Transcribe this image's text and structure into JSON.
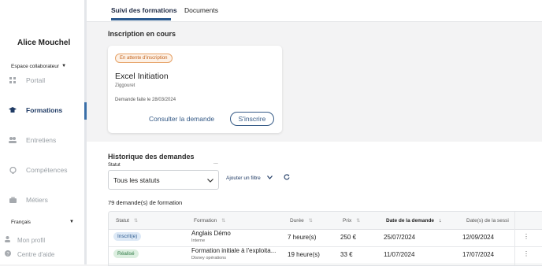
{
  "sidebar": {
    "user_name": "Alice Mouchel",
    "space_select": "Espace collaborateur",
    "nav": [
      {
        "label": "Portail",
        "icon": "grid-icon"
      },
      {
        "label": "Formations",
        "icon": "graduation-cap-icon",
        "active": true
      },
      {
        "label": "Entretiens",
        "icon": "people-icon"
      },
      {
        "label": "Compétences",
        "icon": "badge-icon"
      },
      {
        "label": "Métiers",
        "icon": "briefcase-icon"
      }
    ],
    "language": "Français",
    "footer": [
      {
        "label": "Mon profil",
        "icon": "user-icon"
      },
      {
        "label": "Centre d'aide",
        "icon": "help-icon"
      }
    ]
  },
  "tabs": [
    {
      "label": "Suivi des formations",
      "active": true
    },
    {
      "label": "Documents",
      "active": false
    }
  ],
  "current": {
    "title": "Inscription en cours",
    "card": {
      "badge": "En attente d'inscription",
      "course": "Excel Initiation",
      "organization": "Ziggouret",
      "request_date": "Demande faite le 28/03/2024",
      "view_label": "Consulter la demande",
      "enroll_label": "S'inscrire"
    }
  },
  "history": {
    "title": "Historique des demandes",
    "filter_label": "Statut",
    "filter_more": "...",
    "status_value": "Tous les statuts",
    "add_filter": "Ajouter un filtre",
    "count": "79 demande(s) de formation",
    "columns": [
      "Statut",
      "Formation",
      "Durée",
      "Prix",
      "Date de la demande",
      "Date(s) de la sessi"
    ],
    "rows": [
      {
        "status": "Inscrit(e)",
        "training": "Anglais Démo",
        "training_sub": "Interne",
        "duration": "7 heure(s)",
        "price": "250 €",
        "request_date": "25/07/2024",
        "session_date": "12/09/2024"
      },
      {
        "status": "Réalisé",
        "training": "Formation initiale à l'exploita...",
        "training_sub": "Disney opérations",
        "duration": "19 heure(s)",
        "price": "33 €",
        "request_date": "11/07/2024",
        "session_date": "17/07/2024"
      }
    ]
  },
  "colors": {
    "accent": "#2c5a8f",
    "nav_active": "#1f3a64",
    "pending_badge": "#c2621b",
    "status_inscrit": "#2c5a8f",
    "status_realise": "#2e7a44"
  }
}
